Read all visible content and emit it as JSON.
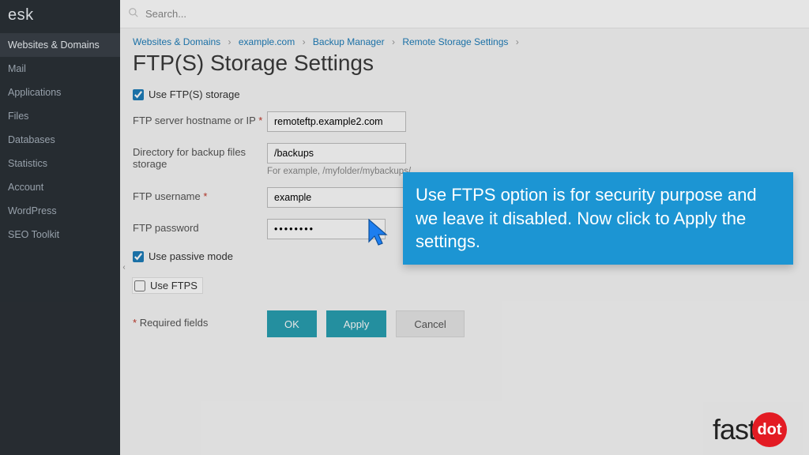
{
  "brand": "esk",
  "sidebar": {
    "items": [
      {
        "label": "Websites & Domains",
        "active": true
      },
      {
        "label": "Mail"
      },
      {
        "label": "Applications"
      },
      {
        "label": "Files"
      },
      {
        "label": "Databases"
      },
      {
        "label": "Statistics"
      },
      {
        "label": "Account"
      },
      {
        "label": "WordPress"
      },
      {
        "label": "SEO Toolkit"
      }
    ]
  },
  "search": {
    "placeholder": "Search..."
  },
  "breadcrumbs": [
    "Websites & Domains",
    "example.com",
    "Backup Manager",
    "Remote Storage Settings"
  ],
  "title": "FTP(S) Storage Settings",
  "form": {
    "use_ftps_storage_label": "Use FTP(S) storage",
    "use_ftps_storage_checked": true,
    "hostname_label": "FTP server hostname or IP",
    "hostname_value": "remoteftp.example2.com",
    "directory_label": "Directory for backup files storage",
    "directory_value": "/backups",
    "directory_hint": "For example, /myfolder/mybackups/",
    "username_label": "FTP username",
    "username_value": "example",
    "password_label": "FTP password",
    "password_value": "••••••••",
    "passive_label": "Use passive mode",
    "passive_checked": true,
    "use_ftps_label": "Use FTPS",
    "use_ftps_checked": false,
    "required_note": "Required fields"
  },
  "buttons": {
    "ok": "OK",
    "apply": "Apply",
    "cancel": "Cancel"
  },
  "tooltip": "Use FTPS option is for security purpose and we leave it disabled. Now click to Apply the settings.",
  "logo": {
    "word": "fast",
    "dot": "dot"
  }
}
